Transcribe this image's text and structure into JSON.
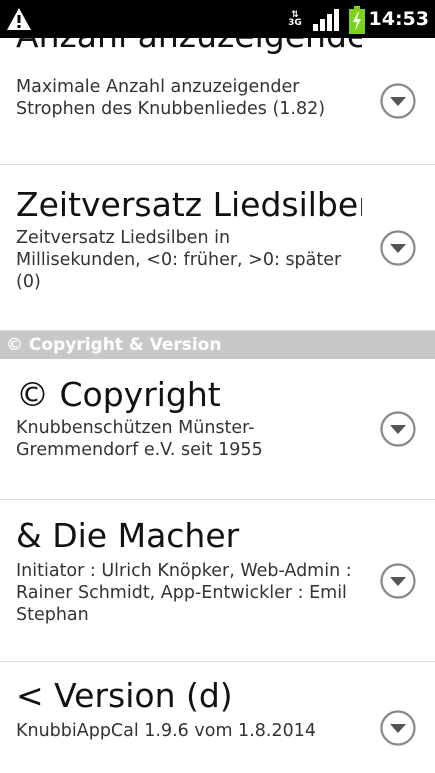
{
  "status_bar": {
    "network_top": "⇅",
    "network_type": "3G",
    "time": "14:53",
    "icons": [
      "warning-icon",
      "data-3g-icon",
      "signal-icon",
      "battery-charging-icon"
    ]
  },
  "preferences": [
    {
      "title": "Anzahl anzuzeigender",
      "summary": "Maximale Anzahl anzuzeigender Strophen des Knubbenliedes (1.82)"
    },
    {
      "title": "Zeitversatz Liedsilben",
      "summary": "Zeitversatz Liedsilben in Millisekunden, <0: früher, >0: später (0)"
    }
  ],
  "category": {
    "label": "© Copyright & Version"
  },
  "category_items": [
    {
      "title": "© Copyright",
      "summary": "Knubbenschützen Münster-Gremmendorf e.V. seit 1955"
    },
    {
      "title": "& Die Macher",
      "summary": "Initiator : Ulrich Knöpker, Web-Admin : Rainer Schmidt, App-Entwickler : Emil Stephan"
    },
    {
      "title": "< Version (d)",
      "summary": "KnubbiAppCal 1.9.6 vom 1.8.2014"
    }
  ],
  "colors": {
    "status_bar_bg": "#000000",
    "category_bg": "#c8c8c8",
    "battery": "#7bd31c",
    "divider": "#dcdcdc"
  }
}
